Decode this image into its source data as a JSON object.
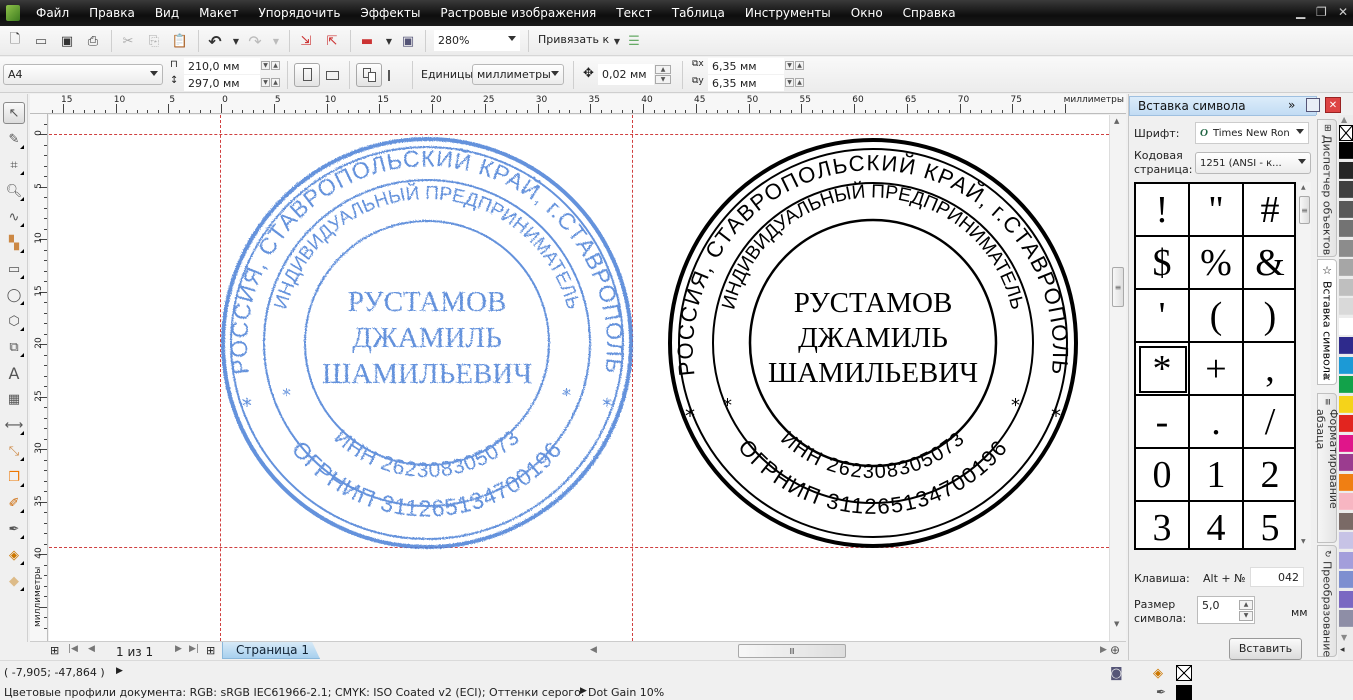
{
  "menubar": {
    "items": [
      "Файл",
      "Правка",
      "Вид",
      "Макет",
      "Упорядочить",
      "Эффекты",
      "Растровые изображения",
      "Текст",
      "Таблица",
      "Инструменты",
      "Окно",
      "Справка"
    ],
    "window_controls": [
      "minimize-icon",
      "restore-icon",
      "close-icon"
    ]
  },
  "toolbar_standard": {
    "icons": [
      "new-document-icon",
      "open-icon",
      "save-icon",
      "print-icon",
      "cut-icon",
      "copy-icon",
      "paste-icon",
      "undo-icon",
      "redo-icon",
      "import-icon",
      "export-icon",
      "application-launcher-icon",
      "welcome-screen-icon"
    ],
    "zoom_value": "280%",
    "snap_label": "Привязать к",
    "snap_options_icon": "snap-options-icon"
  },
  "property_bar": {
    "page_size": "A4",
    "width": "210,0 мм",
    "height": "297,0 мм",
    "units_label": "Единицы:",
    "units_value": "миллиметры",
    "nudge_value": "0,02 мм",
    "dup_x": "6,35 мм",
    "dup_y": "6,35 мм"
  },
  "toolbox": {
    "tools": [
      "pick-tool",
      "shape-tool",
      "crop-tool",
      "zoom-tool",
      "freehand-tool",
      "smart-fill-tool",
      "rectangle-tool",
      "ellipse-tool",
      "polygon-tool",
      "basic-shapes-tool",
      "text-tool",
      "table-tool",
      "dimension-tool",
      "connector-tool",
      "blend-tool",
      "eyedropper-tool",
      "outline-tool",
      "fill-tool",
      "interactive-fill-tool"
    ]
  },
  "rulers": {
    "units_label": "миллиметры",
    "horizontal_labels": [
      "15",
      "10",
      "5",
      "0",
      "5",
      "10",
      "15",
      "20",
      "25",
      "30",
      "35",
      "40",
      "45",
      "50",
      "55",
      "60",
      "65",
      "70",
      "75"
    ],
    "vertical_labels": [
      "0",
      "5",
      "10",
      "15",
      "20",
      "25",
      "30",
      "35",
      "40"
    ],
    "vertical_units_label": "миллиметры"
  },
  "stamp": {
    "outer_text": "РОССИЯ, СТАВРОПОЛЬСКИЙ КРАЙ, г.СТАВРОПОЛЬ",
    "inner_text": "ИНДИВИДУАЛЬНЫЙ ПРЕДПРИНИМАТЕЛЬ",
    "name_lines": [
      "РУСТАМОВ",
      "ДЖАМИЛЬ",
      "ШАМИЛЬЕВИЧ"
    ],
    "inn_text": "ИНН 262308305073",
    "ogrnip_text": "ОГРНИП 311265134700196",
    "separator": "*",
    "scan_color": "#4a7fd6",
    "vector_color": "#000000"
  },
  "page_nav": {
    "page_info": "1 из 1",
    "page_tab": "Страница 1"
  },
  "status": {
    "coordinates": "( -7,905; -47,864 )",
    "color_profiles": "Цветовые профили документа: RGB: sRGB IEC61966-2.1; CMYK: ISO Coated v2 (ECI); Оттенки серого: Dot Gain 10%"
  },
  "docker": {
    "title": "Вставка символа",
    "font_label": "Шрифт:",
    "font_value": "Times New Ron",
    "codepage_label_1": "Кодовая",
    "codepage_label_2": "страница:",
    "codepage_value": "1251  (ANSI - к...",
    "glyphs": [
      "!",
      "\"",
      "#",
      "$",
      "%",
      "&",
      "'",
      "(",
      ")",
      "*",
      "+",
      ",",
      "-",
      ".",
      "/",
      "0",
      "1",
      "2",
      "3",
      "4",
      "5"
    ],
    "selected_glyph": "*",
    "key_label": "Клавиша:",
    "key_prefix": "Alt + №",
    "key_value": "042",
    "size_label_1": "Размер",
    "size_label_2": "символа:",
    "size_value": "5,0",
    "size_unit": "мм",
    "insert_button": "Вставить"
  },
  "side_tabs": [
    "Диспетчер объектов",
    "Вставка символа",
    "Форматирование абзаца",
    "Преобразование"
  ],
  "palette": {
    "colors": [
      "#000000",
      "#262626",
      "#404040",
      "#595959",
      "#737373",
      "#8c8c8c",
      "#a6a6a6",
      "#bfbfbf",
      "#d9d9d9",
      "#ffffff",
      "#2e2a8c",
      "#1c9ad6",
      "#12a24a",
      "#f5d31a",
      "#e2251f",
      "#e0158a",
      "#9b3c8f",
      "#f07f13",
      "#f7b6c2",
      "#7a6a66",
      "#c7c3e6",
      "#a39edb",
      "#7e8fd0",
      "#7a68c2",
      "#8e8ea6"
    ]
  },
  "fill_outline": {
    "fill": "none",
    "outline": "#000000"
  }
}
